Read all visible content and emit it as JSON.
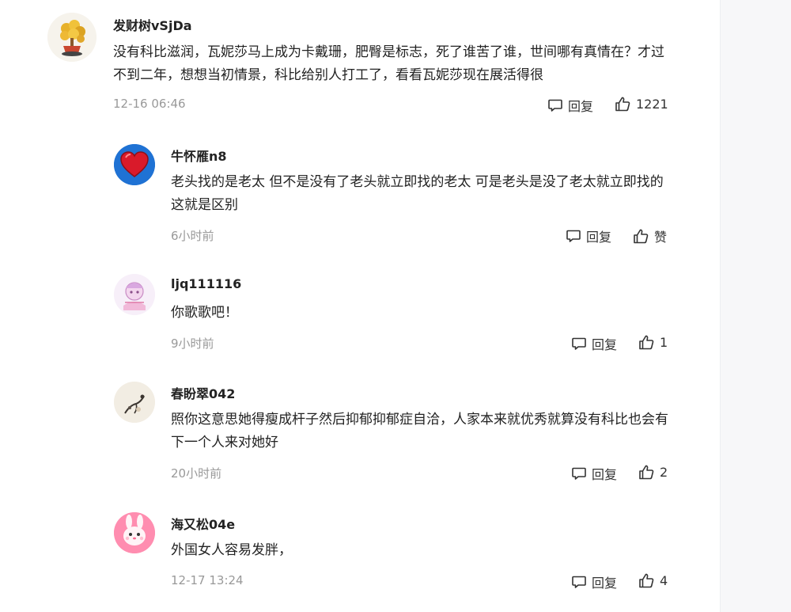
{
  "comments": [
    {
      "username": "发财树vSjDa",
      "text": "没有科比滋润，瓦妮莎马上成为卡戴珊，肥臀是标志，死了谁苦了谁，世间哪有真情在？才过不到二年，想想当初情景，科比给别人打工了，看看瓦妮莎现在展活得很",
      "time": "12-16 06:46",
      "reply_label": "回复",
      "like_label": "1221",
      "avatar_icon": "money-tree-avatar-icon"
    },
    {
      "username": "牛怀雁n8",
      "text": "老头找的是老太 但不是没有了老头就立即找的老太 可是老头是没了老太就立即找的 这就是区别",
      "time": "6小时前",
      "reply_label": "回复",
      "like_label": "赞",
      "avatar_icon": "red-heart-avatar-icon"
    },
    {
      "username": "ljq111116",
      "text": "你歌歌吧！",
      "time": "9小时前",
      "reply_label": "回复",
      "like_label": "1",
      "avatar_icon": "cartoon-avatar-icon"
    },
    {
      "username": "春盼翠042",
      "text": "照你这意思她得瘦成杆子然后抑郁抑郁症自洽，人家本来就优秀就算没有科比也会有下一个人来对她好",
      "time": "20小时前",
      "reply_label": "回复",
      "like_label": "2",
      "avatar_icon": "ink-painting-avatar-icon"
    },
    {
      "username": "海又松04e",
      "text": "外国女人容易发胖，",
      "time": "12-17 13:24",
      "reply_label": "回复",
      "like_label": "4",
      "avatar_icon": "pink-bunny-avatar-icon"
    }
  ],
  "colors": {
    "username": "#222222",
    "body_text": "#222222",
    "meta_text": "#999999",
    "action_text": "#333333",
    "side_panel": "#f7f7f9"
  }
}
